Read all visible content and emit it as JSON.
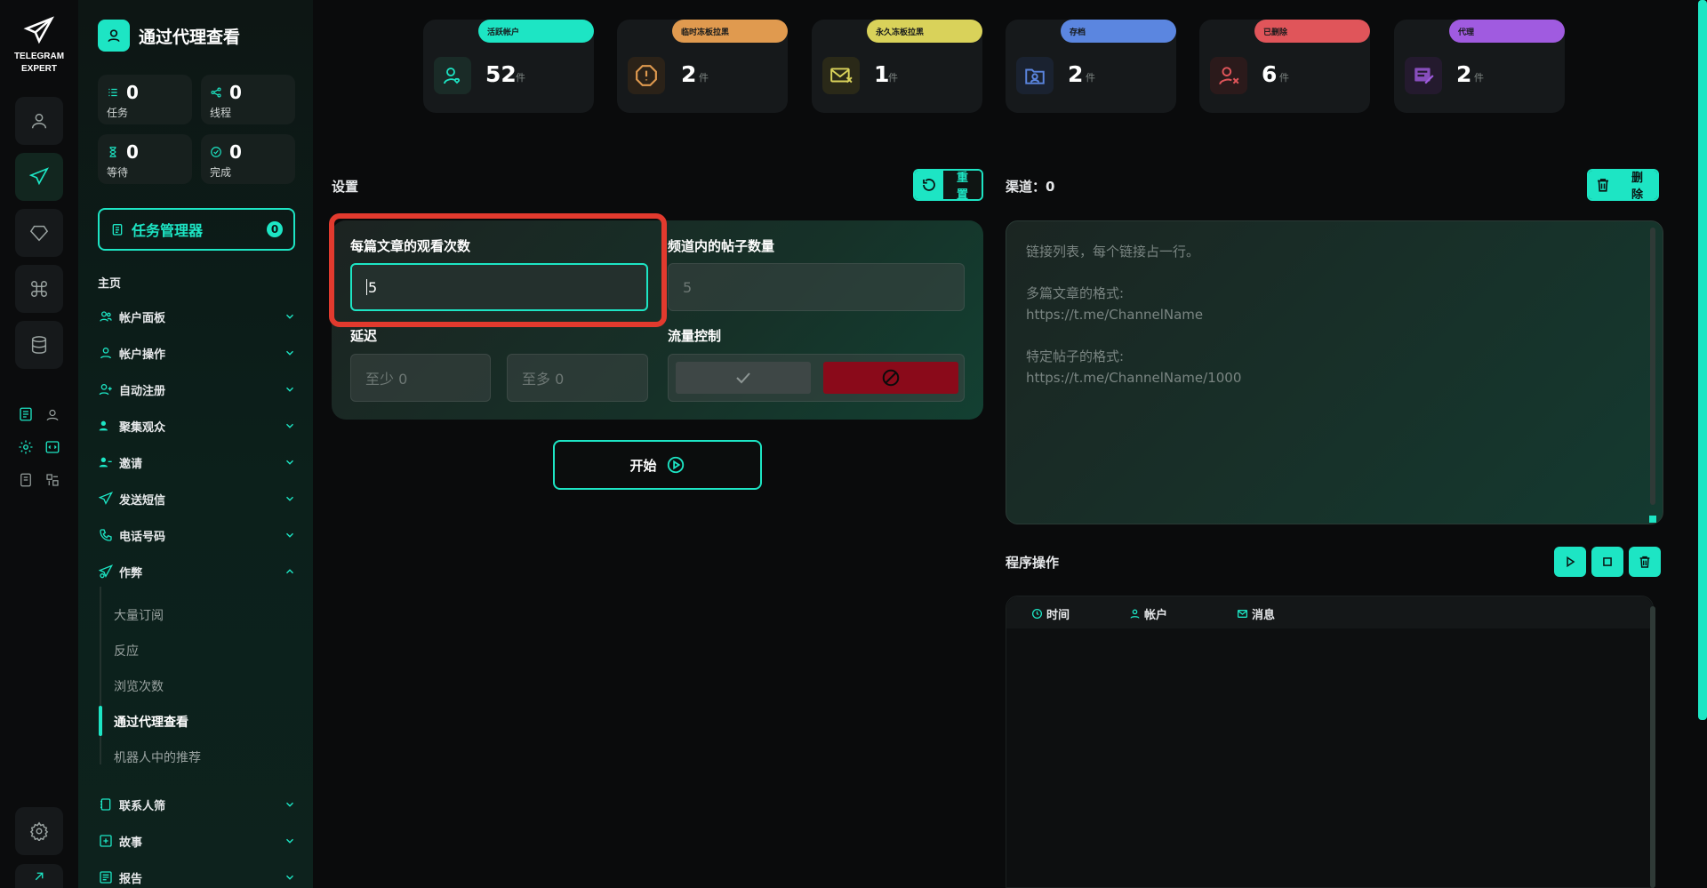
{
  "rail": {
    "brand_line1": "TELEGRAM",
    "brand_line2": "EXPERT",
    "icons": [
      "user-icon",
      "send-icon",
      "gem-icon",
      "command-icon",
      "database-icon"
    ],
    "bottom_icons": [
      "settings-icon",
      "external-link-icon"
    ]
  },
  "sidebar": {
    "title": "通过代理查看",
    "stats": [
      {
        "value": "0",
        "label": "任务",
        "icon": "list-icon"
      },
      {
        "value": "0",
        "label": "线程",
        "icon": "share-icon"
      },
      {
        "value": "0",
        "label": "等待",
        "icon": "hourglass-icon"
      },
      {
        "value": "0",
        "label": "完成",
        "icon": "check-circle-icon"
      }
    ],
    "task_manager_label": "任务管理器",
    "task_manager_count": "0",
    "home_label": "主页",
    "items": [
      {
        "label": "帐户面板",
        "icon": "users-icon",
        "expanded": false
      },
      {
        "label": "帐户操作",
        "icon": "user-icon",
        "expanded": false
      },
      {
        "label": "自动注册",
        "icon": "user-plus-icon",
        "expanded": false
      },
      {
        "label": "聚集观众",
        "icon": "audience-icon",
        "expanded": false
      },
      {
        "label": "邀请",
        "icon": "invite-icon",
        "expanded": false
      },
      {
        "label": "发送短信",
        "icon": "send-icon",
        "expanded": false
      },
      {
        "label": "电话号码",
        "icon": "phone-icon",
        "expanded": false
      },
      {
        "label": "作弊",
        "icon": "cheat-icon",
        "expanded": true
      }
    ],
    "sub_items": [
      "大量订阅",
      "反应",
      "浏览次数",
      "通过代理查看",
      "机器人中的推荐"
    ],
    "active_sub": "通过代理查看",
    "bottom_items": [
      {
        "label": "联系人筛",
        "icon": "contacts-icon"
      },
      {
        "label": "故事",
        "icon": "plus-square-icon"
      },
      {
        "label": "报告",
        "icon": "report-icon"
      }
    ]
  },
  "cards": [
    {
      "pill": "活跃帐户",
      "value": "52",
      "unit": "件",
      "color": "#1de5c4",
      "icon": "user-heart-icon"
    },
    {
      "pill": "临时冻板拉黑",
      "value": "2",
      "unit": "件",
      "color": "#e09a4f",
      "icon": "alert-icon"
    },
    {
      "pill": "永久冻板拉黑",
      "value": "1",
      "unit": "件",
      "color": "#d9d25a",
      "icon": "mail-block-icon"
    },
    {
      "pill": "存档",
      "value": "2",
      "unit": "件",
      "color": "#5b86e0",
      "icon": "folder-user-icon"
    },
    {
      "pill": "已删除",
      "value": "6",
      "unit": "件",
      "color": "#e0555a",
      "icon": "user-x-icon"
    },
    {
      "pill": "代理",
      "value": "2",
      "unit": "件",
      "color": "#a05be0",
      "icon": "proxy-icon"
    }
  ],
  "settings": {
    "label": "设置",
    "reset_label": "重置",
    "views_label": "每篇文章的观看次数",
    "views_value": "5",
    "posts_label": "频道内的帖子数量",
    "posts_placeholder": "5",
    "delay_label": "延迟",
    "delay_min": "至少  0",
    "delay_max": "至多  0",
    "flow_label": "流量控制",
    "start_label": "开始"
  },
  "channels": {
    "label": "渠道：0",
    "delete_label": "删除",
    "placeholder_lines": [
      "链接列表，每个链接占一行。",
      "",
      "多篇文章的格式:",
      "https://t.me/ChannelName",
      "",
      "特定帖子的格式:",
      "https://t.me/ChannelName/1000"
    ]
  },
  "operations": {
    "label": "程序操作",
    "col_time": "时间",
    "col_account": "帐户",
    "col_message": "消息"
  },
  "colors": {
    "accent": "#1de5c4",
    "highlight": "#e23a2e",
    "deny": "#8a0a1a"
  }
}
